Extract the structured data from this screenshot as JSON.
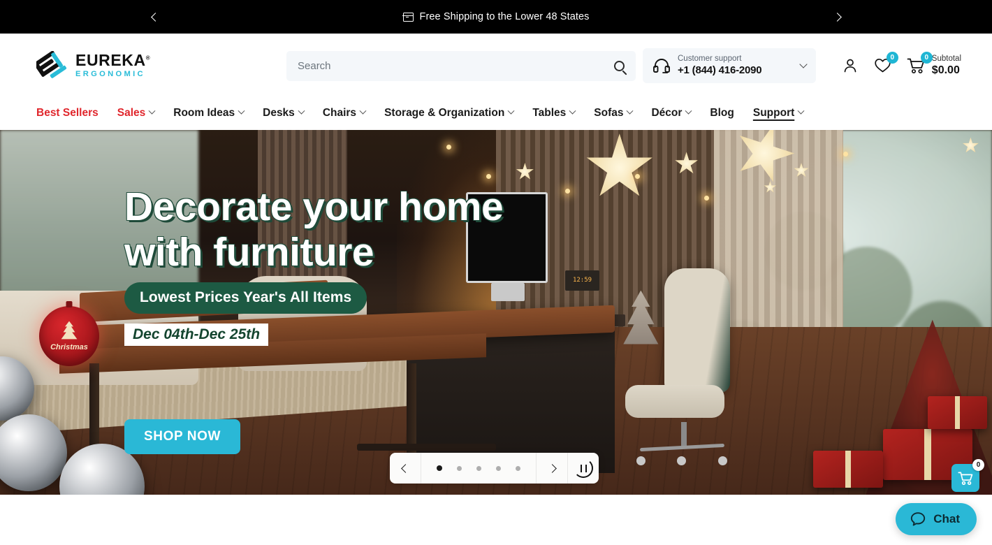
{
  "announcement": {
    "text": "Free Shipping to the Lower 48 States",
    "icon": "box-icon",
    "prev_icon": "chevron-left-icon",
    "next_icon": "chevron-right-icon"
  },
  "header": {
    "logo": {
      "name": "EUREKA",
      "registered": "®",
      "tagline": "ERGONOMIC"
    },
    "search": {
      "placeholder": "Search",
      "value": "",
      "icon": "search-icon"
    },
    "support": {
      "label": "Customer support",
      "phone": "+1 (844) 416-2090",
      "icon": "headset-icon",
      "chevron": "chevron-down-icon"
    },
    "account": {
      "icon": "user-icon"
    },
    "wishlist": {
      "icon": "heart-icon",
      "count": "0"
    },
    "cart": {
      "icon": "cart-icon",
      "count": "0",
      "subtotal_label": "Subtotal",
      "subtotal_value": "$0.00"
    }
  },
  "nav": {
    "items": [
      {
        "label": "Best Sellers",
        "color": "red",
        "has_dropdown": false,
        "active": false
      },
      {
        "label": "Sales",
        "color": "red",
        "has_dropdown": true,
        "active": false
      },
      {
        "label": "Room Ideas",
        "color": "dark",
        "has_dropdown": true,
        "active": false
      },
      {
        "label": "Desks",
        "color": "dark",
        "has_dropdown": true,
        "active": false
      },
      {
        "label": "Chairs",
        "color": "dark",
        "has_dropdown": true,
        "active": false
      },
      {
        "label": "Storage & Organization",
        "color": "dark",
        "has_dropdown": true,
        "active": false
      },
      {
        "label": "Tables",
        "color": "dark",
        "has_dropdown": true,
        "active": false
      },
      {
        "label": "Sofas",
        "color": "dark",
        "has_dropdown": true,
        "active": false
      },
      {
        "label": "Décor",
        "color": "dark",
        "has_dropdown": true,
        "active": false
      },
      {
        "label": "Blog",
        "color": "dark",
        "has_dropdown": false,
        "active": false
      },
      {
        "label": "Support",
        "color": "dark",
        "has_dropdown": true,
        "active": true
      }
    ]
  },
  "hero": {
    "headline_line1": "Decorate your home",
    "headline_line2": "with furniture",
    "pill": "Lowest Prices Year's All Items",
    "date_range": "Dec 04th-Dec 25th",
    "cta": "SHOP NOW",
    "ornament": {
      "label": "Christmas"
    },
    "clock_display": "12:59",
    "carousel": {
      "prev_icon": "chevron-left-icon",
      "next_icon": "chevron-right-icon",
      "pause_icon": "pause-icon",
      "slide_count": 5,
      "active_slide": 1
    }
  },
  "floating": {
    "cart": {
      "icon": "cart-icon",
      "count": "0"
    },
    "chat": {
      "label": "Chat",
      "icon": "chat-bubble-icon"
    }
  },
  "colors": {
    "accent_cyan": "#2ab8d6",
    "badge_cyan": "#1fb6d4",
    "nav_red": "#e0262c",
    "pill_green": "#1d5a43",
    "announcement_bg": "#000000"
  }
}
